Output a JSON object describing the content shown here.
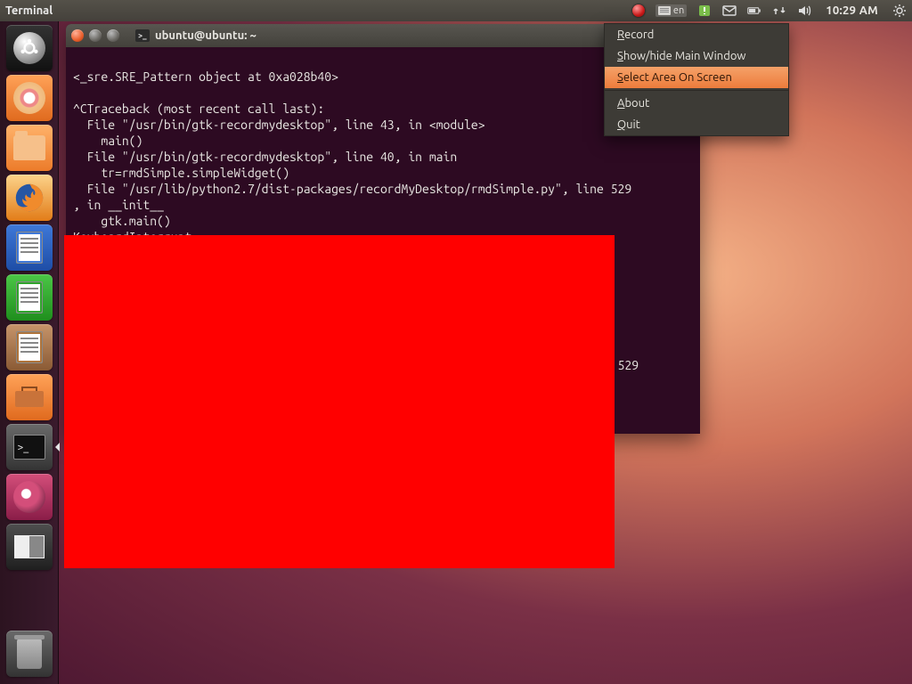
{
  "panel": {
    "app_title": "Terminal",
    "keyboard_lang": "en",
    "clock": "10:29 AM"
  },
  "context_menu": {
    "items": [
      {
        "label": "Record",
        "accel": "R"
      },
      {
        "label": "Show/hide Main Window",
        "accel": "S"
      },
      {
        "label": "Select Area On Screen",
        "accel": "S",
        "highlight": true
      },
      {
        "sep": true
      },
      {
        "label": "About",
        "accel": "A"
      },
      {
        "label": "Quit",
        "accel": "Q"
      }
    ]
  },
  "terminal": {
    "title": "ubuntu@ubuntu: ~",
    "lines": [
      "",
      "<_sre.SRE_Pattern object at 0xa028b40>",
      "",
      "^CTraceback (most recent call last):",
      "  File \"/usr/bin/gtk-recordmydesktop\", line 43, in <module>",
      "    main()",
      "  File \"/usr/bin/gtk-recordmydesktop\", line 40, in main",
      "    tr=rmdSimple.simpleWidget()",
      "  File \"/usr/lib/python2.7/dist-packages/recordMyDesktop/rmdSimple.py\", line 529",
      ", in __init__",
      "    gtk.main()",
      "KeyboardInterrupt",
      "",
      "",
      "",
      "",
      "",
      "",
      "",
      "                                                                      \", line 529"
    ]
  },
  "launcher": {
    "items": [
      {
        "name": "dash",
        "label": "Dash Home"
      },
      {
        "name": "installer",
        "label": "Ubiquity"
      },
      {
        "name": "files",
        "label": "Files"
      },
      {
        "name": "firefox",
        "label": "Firefox"
      },
      {
        "name": "writer",
        "label": "LibreOffice Writer"
      },
      {
        "name": "calc",
        "label": "LibreOffice Calc"
      },
      {
        "name": "impress",
        "label": "LibreOffice Impress"
      },
      {
        "name": "software",
        "label": "Ubuntu Software Center"
      },
      {
        "name": "terminal",
        "label": "Terminal",
        "active": true
      },
      {
        "name": "recordmydesktop",
        "label": "gtk-recordMyDesktop"
      },
      {
        "name": "workspaces",
        "label": "Workspace Switcher"
      },
      {
        "name": "trash",
        "label": "Trash"
      }
    ]
  }
}
